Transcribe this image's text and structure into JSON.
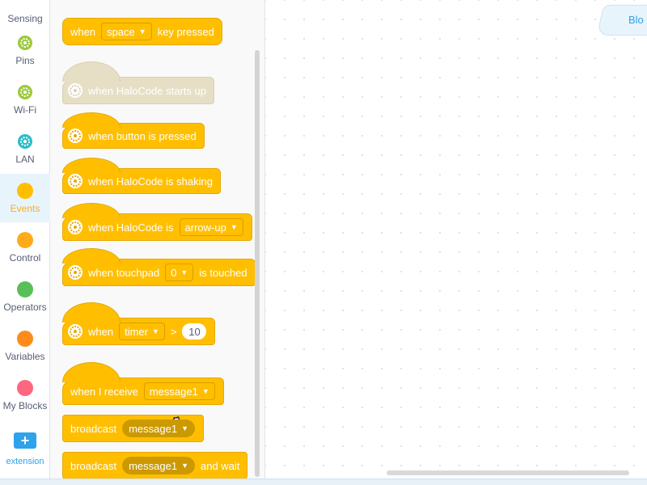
{
  "categories": [
    {
      "id": "sensing",
      "label": "Sensing",
      "color": "#4cbfe6"
    },
    {
      "id": "pins",
      "label": "Pins",
      "color": "#9cc93c"
    },
    {
      "id": "wifi",
      "label": "Wi-Fi",
      "color": "#9cc93c"
    },
    {
      "id": "lan",
      "label": "LAN",
      "color": "#2cbcc7"
    },
    {
      "id": "events",
      "label": "Events",
      "color": "#ffbf00",
      "active": true
    },
    {
      "id": "control",
      "label": "Control",
      "color": "#ffab19"
    },
    {
      "id": "operators",
      "label": "Operators",
      "color": "#59c059"
    },
    {
      "id": "variables",
      "label": "Variables",
      "color": "#ff8c1a"
    },
    {
      "id": "myblocks",
      "label": "My Blocks",
      "color": "#ff6680"
    }
  ],
  "extension": {
    "label": "extension",
    "icon": "plus-icon"
  },
  "blocks": {
    "key_pressed": {
      "when": "when",
      "key": "space",
      "suffix": "key pressed"
    },
    "starts_up": {
      "text": "when HaloCode starts up"
    },
    "button_pressed": {
      "text": "when button is pressed"
    },
    "shaking": {
      "text": "when HaloCode is shaking"
    },
    "halocode_is": {
      "prefix": "when HaloCode is",
      "option": "arrow-up"
    },
    "touchpad": {
      "prefix": "when touchpad",
      "option": "0",
      "suffix": "is touched"
    },
    "timer": {
      "when": "when",
      "option": "timer",
      "op": ">",
      "value": "10"
    },
    "receive": {
      "prefix": "when I receive",
      "option": "message1"
    },
    "broadcast": {
      "prefix": "broadcast",
      "option": "message1"
    },
    "broadcast_wait": {
      "prefix": "broadcast",
      "option": "message1",
      "suffix": "and wait"
    }
  },
  "workspace": {
    "tab_label": "Blo"
  },
  "colors": {
    "event_block": "#ffbf00",
    "event_block_disabled": "#e6dfc6",
    "accent": "#2ea2ea"
  }
}
